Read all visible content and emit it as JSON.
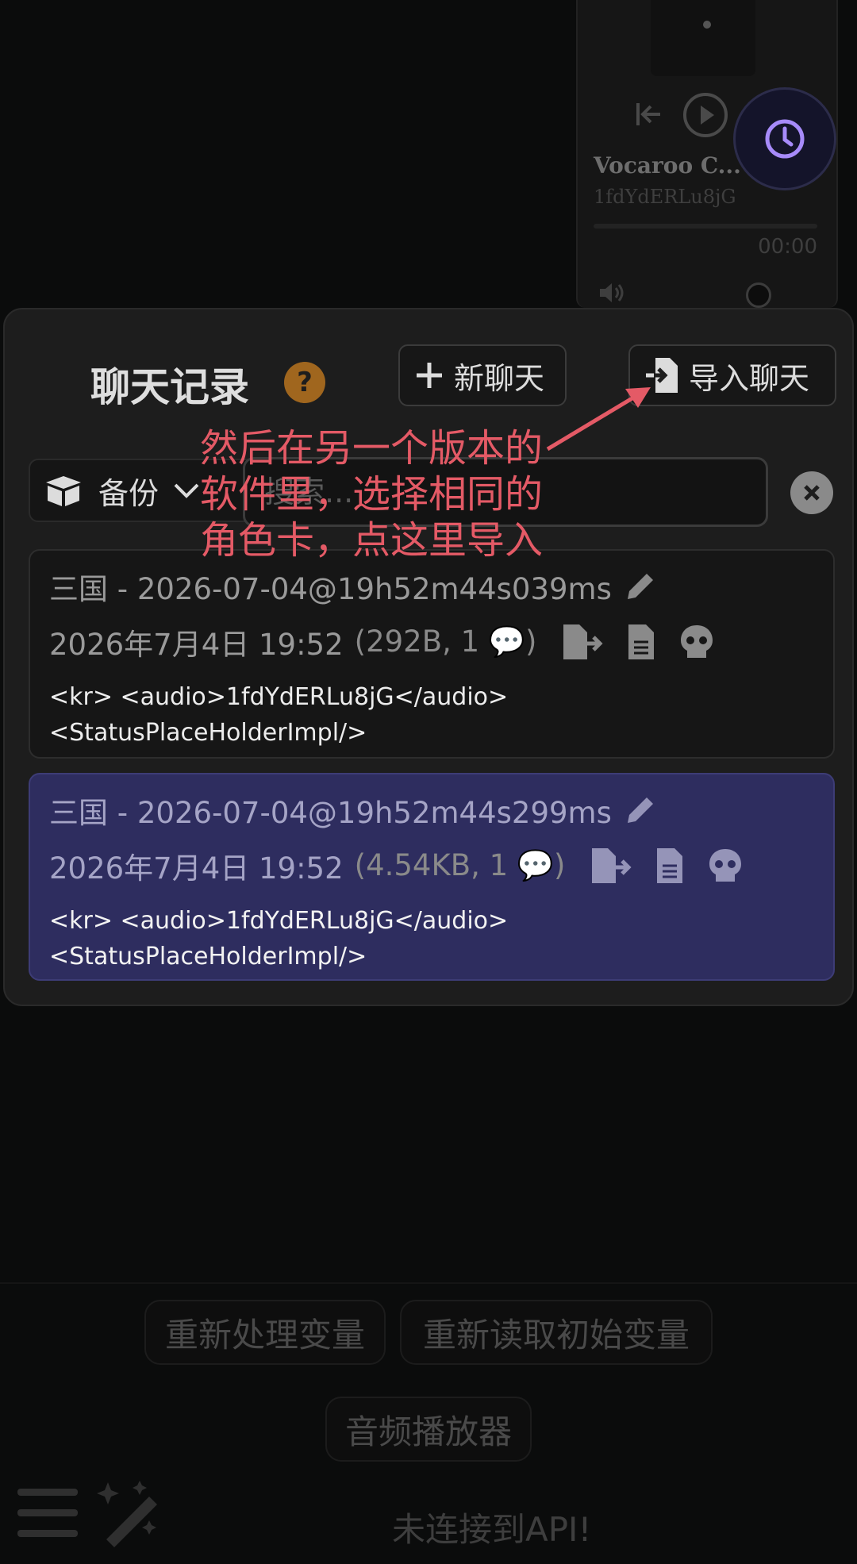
{
  "player": {
    "title": "Vocaroo C...",
    "id": "1fdYdERLu8jG",
    "time": "00:00",
    "icons": [
      "skip-back-icon",
      "play-icon",
      "volume-icon"
    ]
  },
  "floating": {
    "icon": "clock-icon"
  },
  "modal": {
    "title": "聊天记录",
    "help_symbol": "?",
    "new_chat_label": "新聊天",
    "import_chat_label": "导入聊天",
    "backup_label": "备份",
    "search_placeholder": "搜索..."
  },
  "chats": [
    {
      "name": "三国 - 2026-07-04@19h52m44s039ms",
      "date": "2026年7月4日 19:52",
      "stats": "(292B, 1 💬)",
      "preview_line1": "<kr> <audio>1fdYdERLu8jG</audio>",
      "preview_line2": "<StatusPlaceHolderImpl/>",
      "selected": false
    },
    {
      "name": "三国 - 2026-07-04@19h52m44s299ms",
      "date": "2026年7月4日 19:52",
      "stats": "(4.54KB, 1 💬)",
      "preview_line1": "<kr> <audio>1fdYdERLu8jG</audio>",
      "preview_line2": "<StatusPlaceHolderImpl/>",
      "selected": true
    }
  ],
  "annotation": {
    "line1": "然后在另一个版本的",
    "line2": "软件里，选择相同的",
    "line3": "角色卡，点这里导入",
    "color": "#e45a66"
  },
  "bottom": {
    "btn_reprocess": "重新处理变量",
    "btn_reload": "重新读取初始变量",
    "btn_audio": "音频播放器",
    "status": "未连接到API!"
  },
  "colors": {
    "accent_selected": "#2e2d5f",
    "help_badge": "#a0661e",
    "clock_accent": "#a78bfa"
  }
}
